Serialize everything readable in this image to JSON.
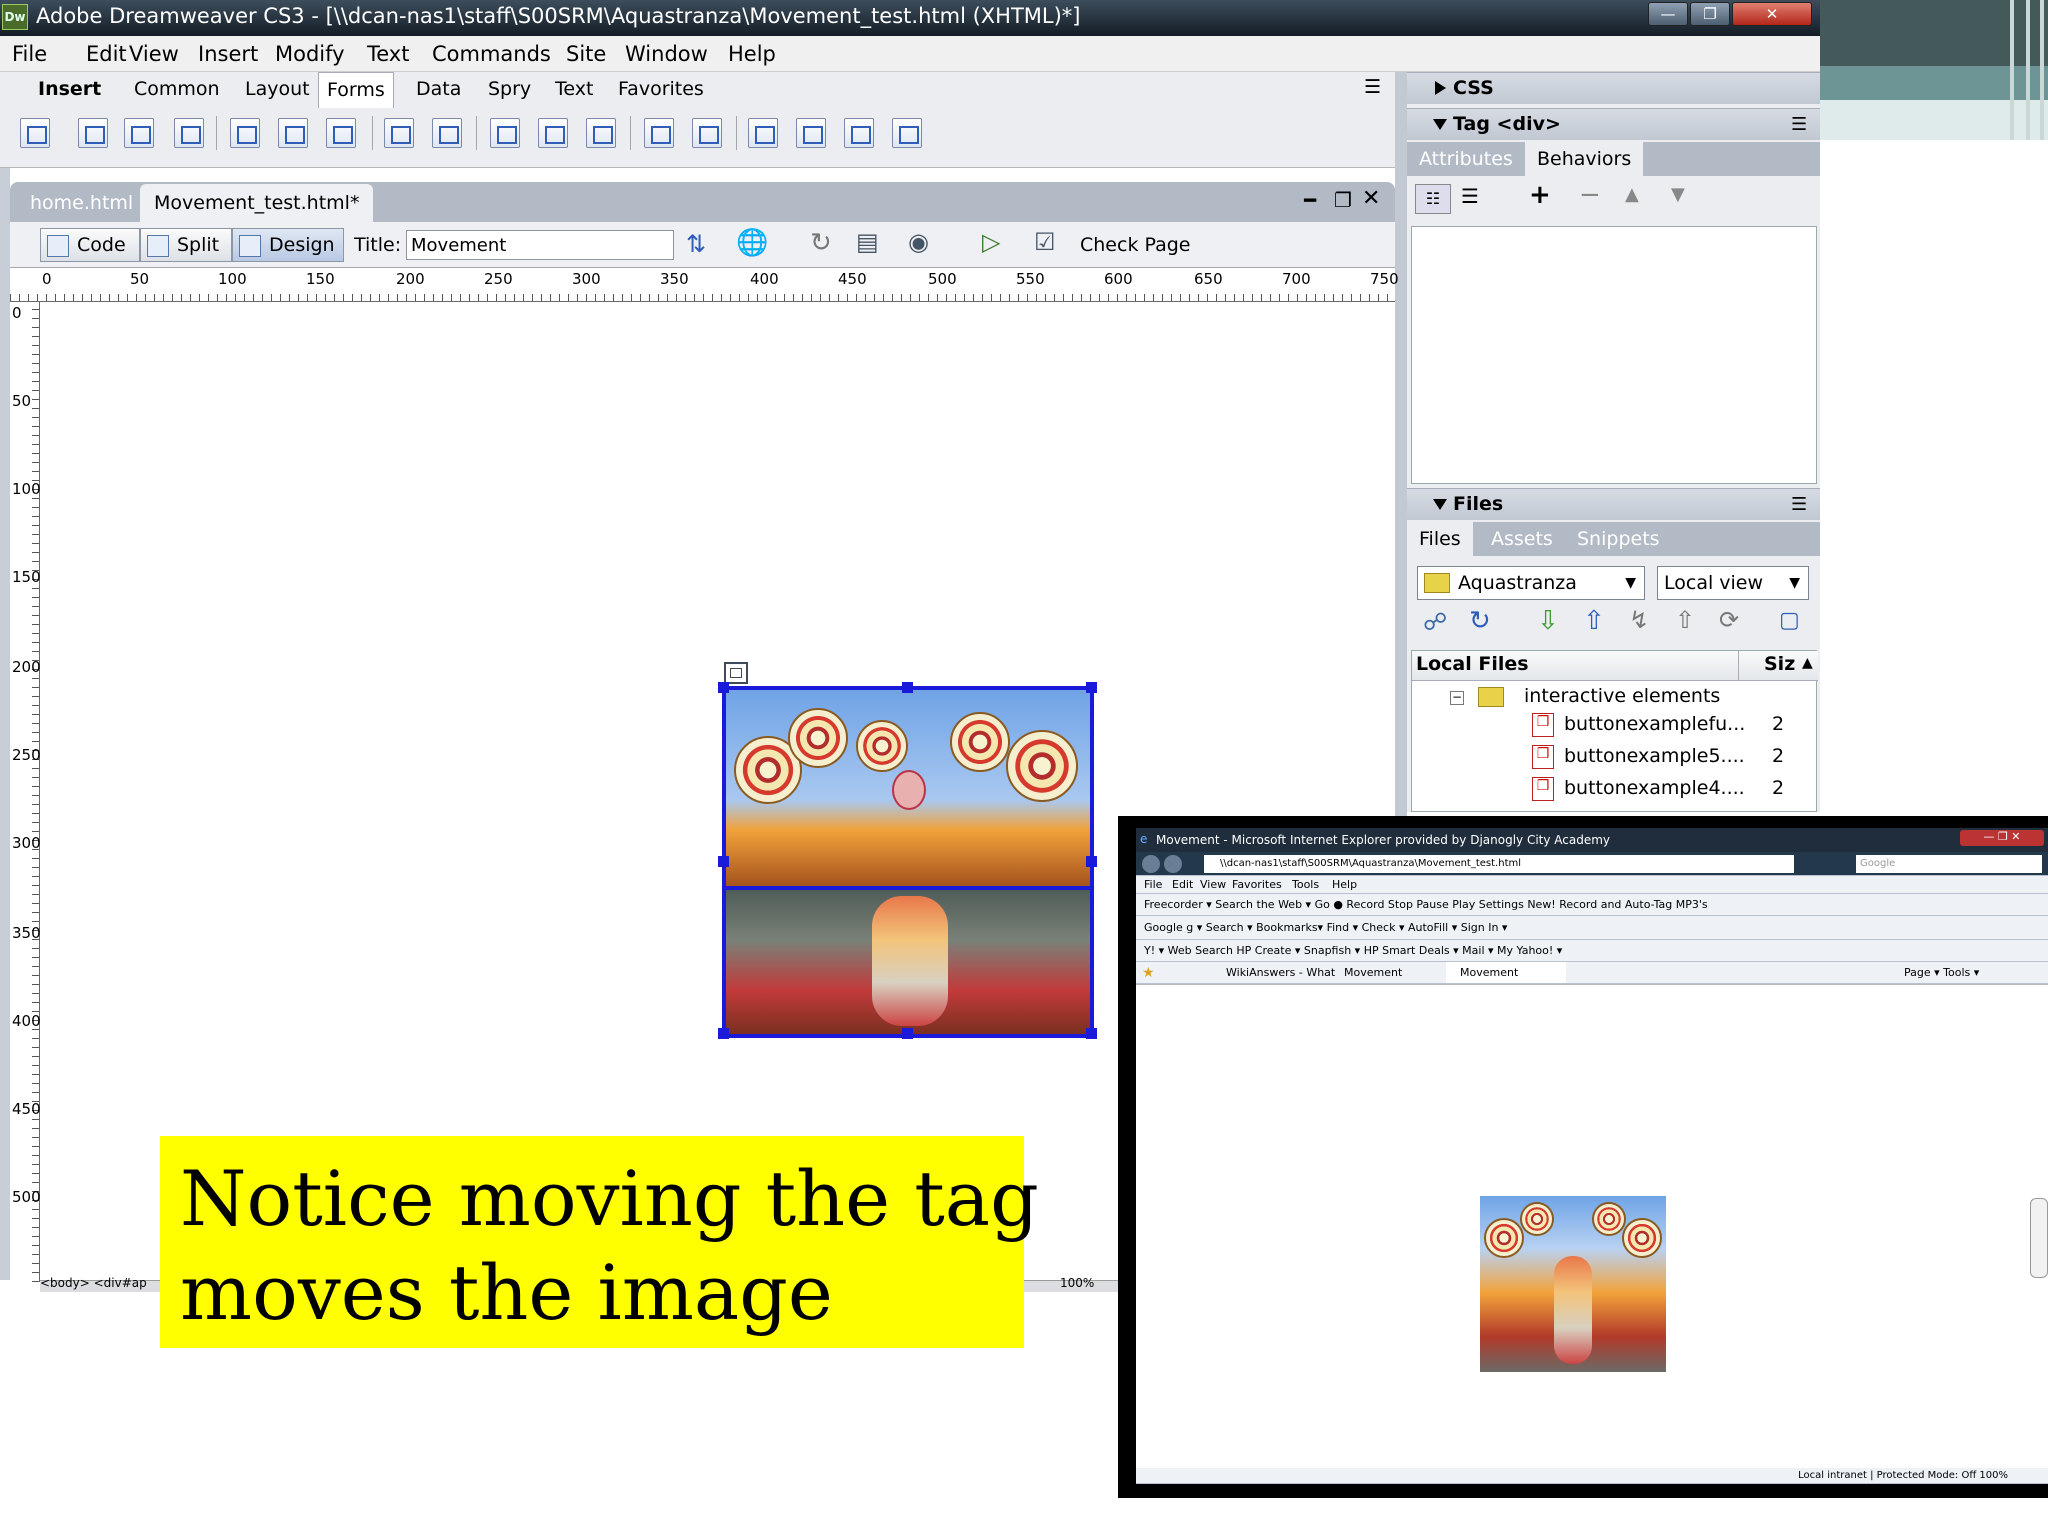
{
  "window": {
    "app_icon": "Dw",
    "title": "Adobe Dreamweaver CS3 - [\\\\dcan-nas1\\staff\\S00SRM\\Aquastranza\\Movement_test.html (XHTML)*]"
  },
  "menu": [
    "File",
    "Edit",
    "View",
    "Insert",
    "Modify",
    "Text",
    "Commands",
    "Site",
    "Window",
    "Help"
  ],
  "insert_bar": {
    "label": "Insert",
    "tabs": [
      "Common",
      "Layout",
      "Forms",
      "Data",
      "Spry",
      "Text",
      "Favorites"
    ],
    "active_tab": "Forms"
  },
  "document": {
    "tabs": [
      "home.html",
      "Movement_test.html*"
    ],
    "view_buttons": [
      "Code",
      "Split",
      "Design"
    ],
    "title_label": "Title:",
    "title_value": "Movement",
    "check_page": "Check Page",
    "ruler_top": [
      "0",
      "50",
      "100",
      "150",
      "200",
      "250",
      "300",
      "350",
      "400",
      "450",
      "500",
      "550",
      "600",
      "650",
      "700",
      "750"
    ],
    "ruler_left": [
      "0",
      "50",
      "100",
      "150",
      "200",
      "250",
      "300",
      "350",
      "400",
      "450",
      "500"
    ]
  },
  "panels": {
    "css_header": "CSS",
    "tag_header": "Tag <div>",
    "tag_tabs": [
      "Attributes",
      "Behaviors"
    ],
    "files_header": "Files",
    "files_tabs": [
      "Files",
      "Assets",
      "Snippets"
    ],
    "site_select": "Aquastranza",
    "view_select": "Local view",
    "col_local": "Local Files",
    "col_size": "Siz",
    "tree": [
      {
        "name": "interactive elements",
        "size": ""
      },
      {
        "name": "buttonexamplefu...",
        "size": "2"
      },
      {
        "name": "buttonexample5....",
        "size": "2"
      },
      {
        "name": "buttonexample4....",
        "size": "2"
      }
    ]
  },
  "caption": {
    "line1": "Notice moving the tag",
    "line2": "moves the image"
  },
  "status": {
    "tag_path": "<body> <div#ap",
    "zoom": "100%"
  },
  "ie": {
    "title": "Movement - Microsoft Internet Explorer provided by Djanogly City Academy",
    "address": "\\\\dcan-nas1\\staff\\S00SRM\\Aquastranza\\Movement_test.html",
    "search_placeholder": "Google",
    "menu": [
      "File",
      "Edit",
      "View",
      "Favorites",
      "Tools",
      "Help"
    ],
    "toolbar1": "Freecorder ▾   Search the Web   ▾ Go  ● Record  Stop  Pause  Play  Settings  New! Record and Auto-Tag MP3's",
    "toolbar2": "Google  g ▾   Search ▾   Bookmarks▾   Find ▾   Check ▾   AutoFill ▾   Sign In ▾",
    "toolbar3": "Y! ▾   Web Search   HP Create ▾   Snapfish ▾   HP Smart Deals ▾   Mail ▾   My Yahoo! ▾",
    "tabs": [
      "WikiAnswers - What does ...",
      "Movement",
      "Movement"
    ],
    "tools": "Page ▾   Tools ▾",
    "statusbar": "Local intranet | Protected Mode: Off    100%"
  }
}
